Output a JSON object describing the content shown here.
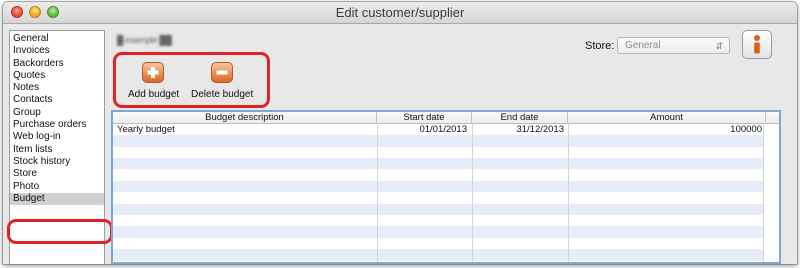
{
  "window": {
    "title": "Edit customer/supplier"
  },
  "sidebar": {
    "items": [
      {
        "label": "General"
      },
      {
        "label": "Invoices"
      },
      {
        "label": "Backorders"
      },
      {
        "label": "Quotes"
      },
      {
        "label": "Notes"
      },
      {
        "label": "Contacts"
      },
      {
        "label": "Group"
      },
      {
        "label": "Purchase orders"
      },
      {
        "label": "Web log-in"
      },
      {
        "label": "Item lists"
      },
      {
        "label": "Stock history"
      },
      {
        "label": "Store"
      },
      {
        "label": "Photo"
      },
      {
        "label": "Budget",
        "selected": true
      }
    ]
  },
  "header": {
    "customer_name": "█ example ██"
  },
  "store": {
    "label": "Store:",
    "value": "General",
    "arrow_icon": "updown-chevron-icon"
  },
  "info_button": {
    "icon": "info-icon",
    "accent": "#e25a1c"
  },
  "toolbar": {
    "add_label": "Add budget",
    "add_icon": "plus-icon",
    "delete_label": "Delete budget",
    "delete_icon": "minus-icon"
  },
  "highlight_color": "#e02424",
  "table": {
    "columns": [
      "Budget description",
      "Start date",
      "End date",
      "Amount"
    ],
    "rows": [
      {
        "description": "Yearly budget",
        "start": "01/01/2013",
        "end": "31/12/2013",
        "amount": "100000"
      }
    ]
  }
}
